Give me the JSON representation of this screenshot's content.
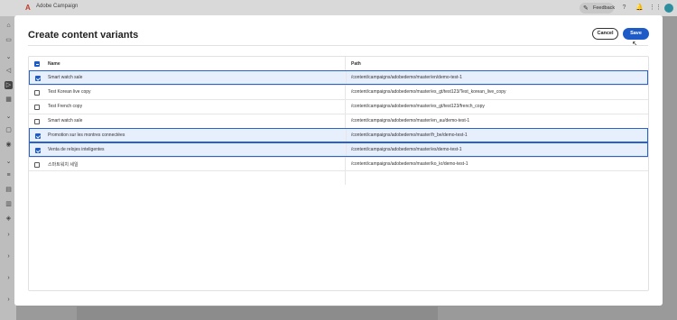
{
  "app": {
    "title": "Adobe Campaign",
    "feedback_label": "Feedback"
  },
  "modal": {
    "title": "Create content variants",
    "cancel_label": "Cancel",
    "save_label": "Save"
  },
  "table": {
    "headers": {
      "name": "Name",
      "path": "Path"
    },
    "rows": [
      {
        "name": "Smart watch sale",
        "path": "/content/campaigns/adobedemo/master/en/demo-test-1",
        "selected": true
      },
      {
        "name": "Test Korean live copy",
        "path": "/content/campaigns/adobedemo/master/es_gt/test123/Test_korean_live_copy",
        "selected": false
      },
      {
        "name": "Test French copy",
        "path": "/content/campaigns/adobedemo/master/es_gt/test123/french_copy",
        "selected": false
      },
      {
        "name": "Smart watch sale",
        "path": "/content/campaigns/adobedemo/master/en_au/demo-test-1",
        "selected": false
      },
      {
        "name": "Promotion sur les montres connectées",
        "path": "/content/campaigns/adobedemo/master/fr_be/demo-test-1",
        "selected": true
      },
      {
        "name": "Venta de relojes inteligentes",
        "path": "/content/campaigns/adobedemo/master/es/demo-test-1",
        "selected": true
      },
      {
        "name": "스마트워치 세일",
        "path": "/content/campaigns/adobedemo/master/ko_kr/demo-test-1",
        "selected": false
      }
    ]
  },
  "colors": {
    "accent": "#1e5bc6",
    "selected_row_bg": "#e7eefc",
    "overlay": "#6b6b6b"
  }
}
